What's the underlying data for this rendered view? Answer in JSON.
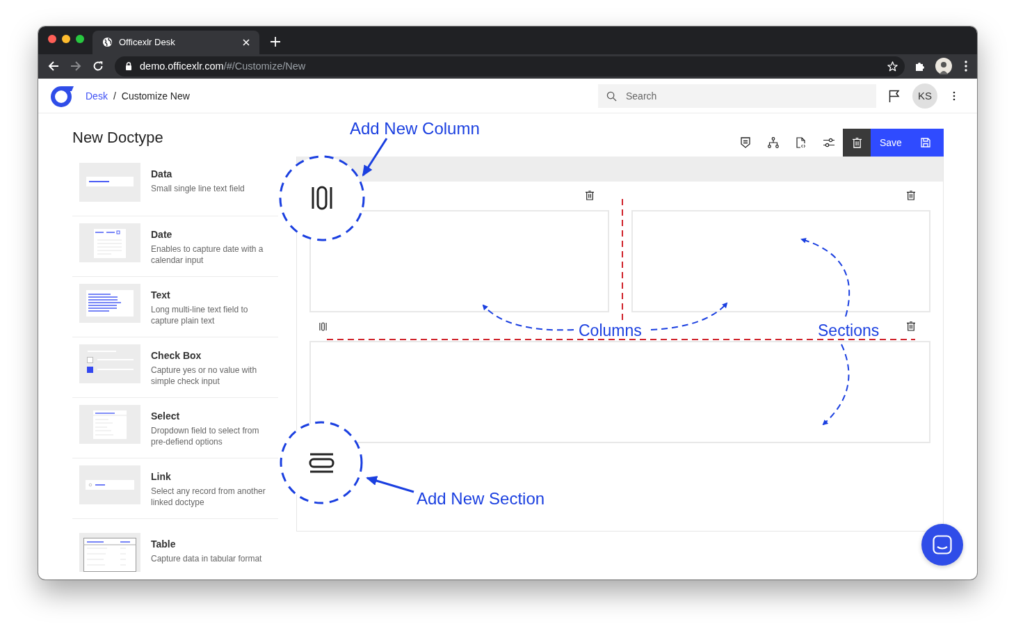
{
  "browser": {
    "tab_title": "Officexlr Desk",
    "url_host": "demo.officexlr.com",
    "url_path": "/#/Customize/New"
  },
  "header": {
    "breadcrumb": [
      {
        "label": "Desk",
        "kind": "link"
      },
      {
        "label": "Customize New",
        "kind": "current"
      }
    ],
    "separator": "/",
    "search": {
      "placeholder": "Search"
    },
    "avatar_initials": "KS"
  },
  "page_title": "New Doctype",
  "field_types": [
    {
      "kind": "data",
      "name": "Data",
      "description": "Small single line text field"
    },
    {
      "kind": "date",
      "name": "Date",
      "description": "Enables to capture date with a calendar input"
    },
    {
      "kind": "text",
      "name": "Text",
      "description": "Long multi-line text field to capture plain text"
    },
    {
      "kind": "checkbox",
      "name": "Check Box",
      "description": "Capture yes or no value with simple check input"
    },
    {
      "kind": "select",
      "name": "Select",
      "description": "Dropdown field to select from pre-defiend options"
    },
    {
      "kind": "link",
      "name": "Link",
      "description": "Select any record from another linked doctype"
    },
    {
      "kind": "table",
      "name": "Table",
      "description": "Capture data in tabular format"
    }
  ],
  "toolbar": {
    "save_label": "Save"
  },
  "canvas": {
    "sections": [
      {
        "kind": "two_column"
      },
      {
        "kind": "one_column"
      }
    ]
  },
  "annotations": [
    {
      "kind": "add_column",
      "text": "Add New Column"
    },
    {
      "kind": "columns",
      "text": "Columns"
    },
    {
      "kind": "sections",
      "text": "Sections"
    },
    {
      "kind": "add_section",
      "text": "Add New Section"
    }
  ]
}
